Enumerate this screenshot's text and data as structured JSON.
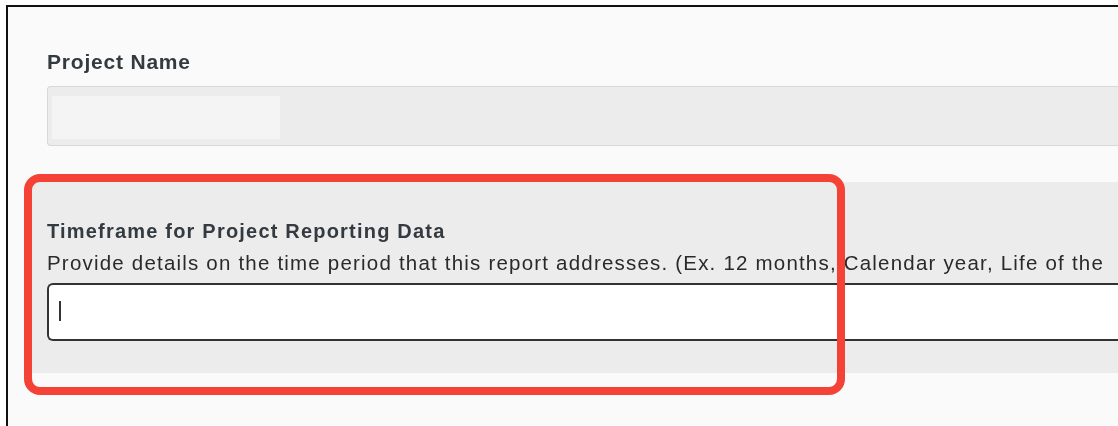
{
  "fields": [
    {
      "kind": "readonly",
      "label": "Project Name",
      "redacted": true
    },
    {
      "kind": "text",
      "label": "Timeframe for Project Reporting Data",
      "description": "Provide details on the time period that this report addresses. (Ex. 12 months, Calendar year, Life of the",
      "focused": true,
      "highlighted": true
    }
  ]
}
